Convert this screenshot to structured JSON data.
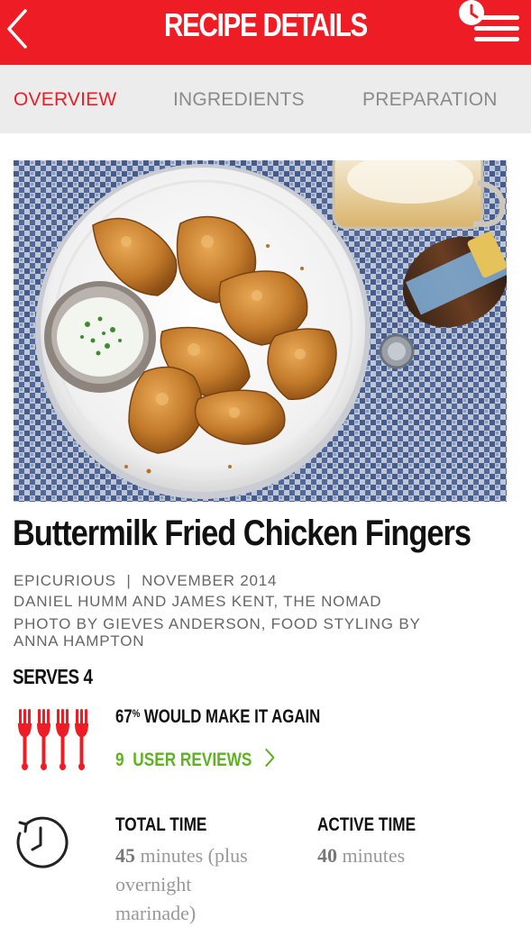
{
  "header": {
    "title": "RECIPE DETAILS",
    "accent": "#ee1c25"
  },
  "tabs": [
    {
      "label": "OVERVIEW",
      "active": true
    },
    {
      "label": "INGREDIENTS",
      "active": false
    },
    {
      "label": "PREPARATION",
      "active": false
    }
  ],
  "recipe": {
    "title": "Buttermilk Fried Chicken Fingers",
    "source": "EPICURIOUS",
    "separator": "|",
    "date": "NOVEMBER 2014",
    "authors": "DANIEL HUMM AND JAMES KENT, THE NOMAD",
    "credit_line1": "PHOTO BY GIEVES ANDERSON, FOOD STYLING BY",
    "credit_line2": "ANNA HAMPTON",
    "serves": "SERVES 4"
  },
  "rating": {
    "percent": "67",
    "percent_sign": "%",
    "make_again_text": "WOULD MAKE IT AGAIN",
    "reviews_count": "9",
    "reviews_label": "USER REVIEWS",
    "reviews_color": "#5fb322",
    "forks_filled": 4
  },
  "times": {
    "total_label": "TOTAL TIME",
    "total_number": "45",
    "total_line1": "minutes (plus",
    "total_line2": "overnight",
    "total_line3": "marinade)",
    "active_label": "ACTIVE TIME",
    "active_number": "40",
    "active_unit": "minutes"
  },
  "icons": {
    "back": "chevron-left-icon",
    "menu": "timer-menu-icon",
    "rating": "fork-icon",
    "time": "clock-icon"
  }
}
